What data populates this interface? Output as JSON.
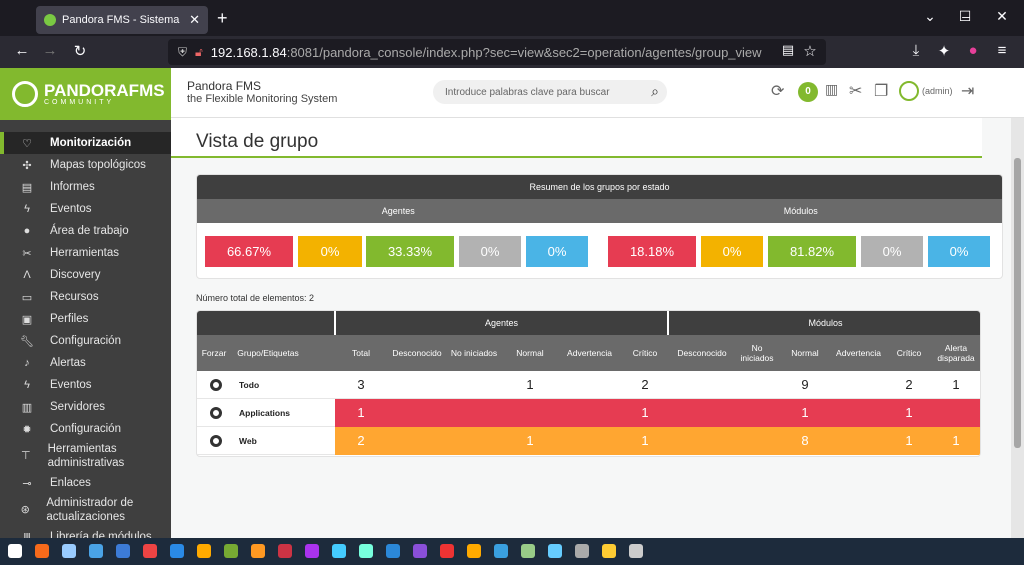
{
  "browser": {
    "tab_title": "Pandora FMS - Sistema Flexible",
    "url_host": "192.168.1.84",
    "url_rest": ":8081/pandora_console/index.php?sec=view&sec2=operation/agentes/group_view"
  },
  "logo": {
    "name": "PANDORAFMS",
    "sub": "COMMUNITY"
  },
  "sidebar": {
    "items": [
      {
        "label": "Monitorización",
        "icon": "heartbeat-icon"
      },
      {
        "label": "Mapas topológicos",
        "icon": "network-map-icon"
      },
      {
        "label": "Informes",
        "icon": "report-icon"
      },
      {
        "label": "Eventos",
        "icon": "lightning-icon"
      },
      {
        "label": "Área de trabajo",
        "icon": "user-icon"
      },
      {
        "label": "Herramientas",
        "icon": "tools-icon"
      },
      {
        "label": "Discovery",
        "icon": "discovery-icon"
      },
      {
        "label": "Recursos",
        "icon": "resources-icon"
      },
      {
        "label": "Perfiles",
        "icon": "profile-icon"
      },
      {
        "label": "Configuración",
        "icon": "wrench-icon"
      },
      {
        "label": "Alertas",
        "icon": "bell-icon"
      },
      {
        "label": "Eventos",
        "icon": "lightning-gear-icon"
      },
      {
        "label": "Servidores",
        "icon": "server-icon"
      },
      {
        "label": "Configuración",
        "icon": "gear-icon"
      },
      {
        "label": "Herramientas administrativas",
        "icon": "admin-tools-icon"
      },
      {
        "label": "Enlaces",
        "icon": "link-icon"
      },
      {
        "label": "Administrador de actualizaciones",
        "icon": "update-icon"
      },
      {
        "label": "Librería de módulos",
        "icon": "library-icon"
      }
    ]
  },
  "header": {
    "brand_line1": "Pandora FMS",
    "brand_line2": "the Flexible Monitoring System",
    "search_placeholder": "Introduce palabras clave para buscar",
    "notification_count": "0",
    "user_label": "(admin)"
  },
  "page": {
    "title": "Vista de grupo",
    "summary_title": "Resumen de los grupos por estado",
    "agents_label": "Agentes",
    "modules_label": "Módulos",
    "agent_pcts": [
      "66.67%",
      "0%",
      "33.33%",
      "0%",
      "0%"
    ],
    "module_pcts": [
      "18.18%",
      "0%",
      "81.82%",
      "0%",
      "0%"
    ],
    "total_elements": "Número total de elementos: 2"
  },
  "colors": {
    "critical": "#e63c52",
    "warning": "#f3b200",
    "normal": "#82b92e",
    "unknown": "#b2b2b2",
    "notinit": "#4ab4e6",
    "orange": "#ffa631",
    "brand": "#82b92e"
  },
  "table": {
    "group_agents": "Agentes",
    "group_modules": "Módulos",
    "columns": [
      "Forzar",
      "Grupo/Etiquetas",
      "Total",
      "Desconocido",
      "No iniciados",
      "Normal",
      "Advertencia",
      "Crítico",
      "Desconocido",
      "No iniciados",
      "Normal",
      "Advertencia",
      "Crítico",
      "Alerta disparada"
    ],
    "rows": [
      {
        "name": "Todo",
        "values": [
          "3",
          "",
          "",
          "1",
          "",
          "2",
          "",
          "",
          "9",
          "",
          "2",
          "1"
        ]
      },
      {
        "name": "Applications",
        "values": [
          "1",
          "",
          "",
          "",
          "",
          "1",
          "",
          "",
          "1",
          "",
          "1",
          ""
        ]
      },
      {
        "name": "Web",
        "values": [
          "2",
          "",
          "",
          "1",
          "",
          "1",
          "",
          "",
          "8",
          "",
          "1",
          "1"
        ]
      }
    ]
  }
}
